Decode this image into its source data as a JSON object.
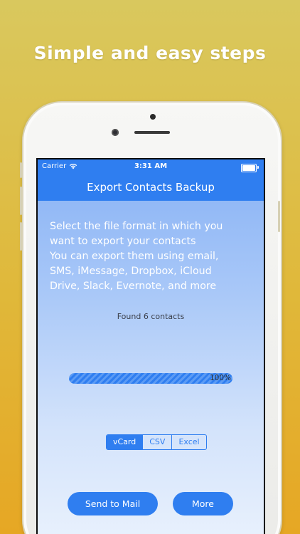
{
  "headline": "Simple and easy steps",
  "status_bar": {
    "carrier": "Carrier",
    "time": "3:31 AM"
  },
  "nav": {
    "title": "Export Contacts Backup"
  },
  "instructions": "Select the file format in which you\nwant to export your contacts\nYou can export them using email,\nSMS, iMessage, Dropbox, iCloud\nDrive, Slack, Evernote, and more",
  "found_text": "Found 6 contacts",
  "progress": {
    "label": "100%",
    "percent": 100
  },
  "formats": {
    "options": [
      "vCard",
      "CSV",
      "Excel"
    ],
    "selected": "vCard"
  },
  "buttons": {
    "send_mail": "Send to Mail",
    "more": "More"
  },
  "icons": {
    "wifi": "wifi-icon",
    "battery": "battery-icon"
  },
  "colors": {
    "accent": "#2f7ef0",
    "background_top": "#d9c85e",
    "background_bottom": "#e6a724"
  }
}
